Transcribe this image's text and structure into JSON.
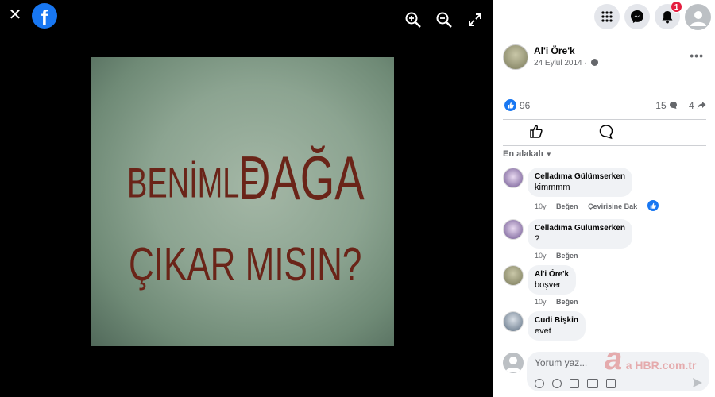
{
  "viewer": {
    "close_icon": "close-icon",
    "logo_letter": "f",
    "zoom_in_icon": "zoom-in-icon",
    "zoom_out_icon": "zoom-out-icon",
    "fullscreen_icon": "fullscreen-icon",
    "photo_text_line1a": "BENİMLE",
    "photo_text_line1b": "DAĞA",
    "photo_text_line2": "ÇIKAR MISIN?"
  },
  "topbar": {
    "notification_count": "1"
  },
  "post": {
    "author": "Al'i Öre'k",
    "date": "24 Eylül 2014 ·",
    "like_count": "96",
    "comment_count": "15",
    "share_count": "4"
  },
  "comments": {
    "sort_label": "En alakalı",
    "items": [
      {
        "name": "Celladıma Gülümserken",
        "text": "kimmmm",
        "age": "10y",
        "like": "Beğen",
        "translate": "Çevirisine Bak"
      },
      {
        "name": "Celladıma Gülümserken",
        "text": "?",
        "age": "10y",
        "like": "Beğen"
      },
      {
        "name": "Al'i Öre'k",
        "text": "boşver",
        "age": "10y",
        "like": "Beğen"
      },
      {
        "name": "Cudi Bişkin",
        "text": "evet"
      }
    ],
    "input_placeholder": "Yorum yaz..."
  },
  "watermark": "a HBR.com.tr",
  "colors": {
    "accent": "#1877f2",
    "badge": "#e41e3f"
  }
}
